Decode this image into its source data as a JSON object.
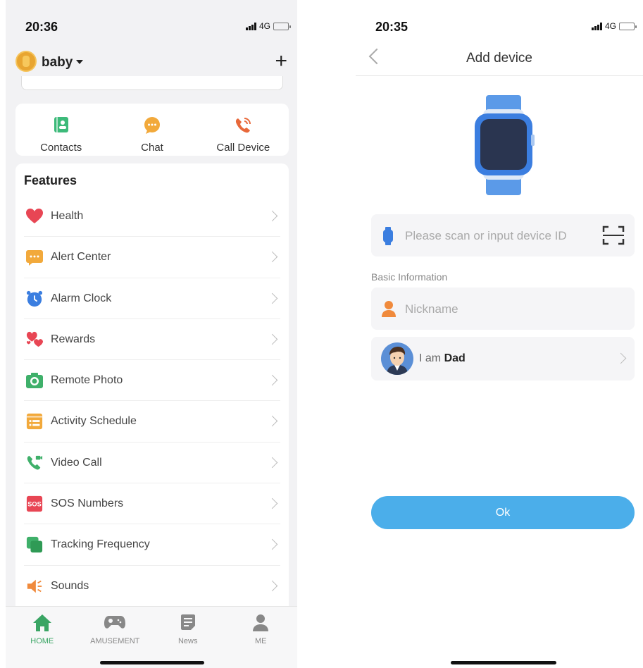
{
  "left": {
    "status": {
      "time": "20:36",
      "network": "4G"
    },
    "header": {
      "device_name": "baby"
    },
    "quick_actions": [
      {
        "label": "Contacts",
        "icon": "contacts-icon",
        "color": "#3dba7a"
      },
      {
        "label": "Chat",
        "icon": "chat-icon",
        "color": "#f2a93b"
      },
      {
        "label": "Call Device",
        "icon": "phone-call-icon",
        "color": "#e8683a"
      }
    ],
    "features": {
      "title": "Features",
      "items": [
        {
          "label": "Health",
          "icon": "heart-icon"
        },
        {
          "label": "Alert Center",
          "icon": "alert-message-icon"
        },
        {
          "label": "Alarm Clock",
          "icon": "alarm-clock-icon"
        },
        {
          "label": "Rewards",
          "icon": "hearts-reward-icon"
        },
        {
          "label": "Remote Photo",
          "icon": "camera-icon"
        },
        {
          "label": "Activity Schedule",
          "icon": "schedule-icon"
        },
        {
          "label": "Video Call",
          "icon": "video-call-icon"
        },
        {
          "label": "SOS Numbers",
          "icon": "sos-icon",
          "icon_text": "SOS"
        },
        {
          "label": "Tracking Frequency",
          "icon": "tracking-icon"
        },
        {
          "label": "Sounds",
          "icon": "speaker-icon"
        }
      ]
    },
    "tabs": [
      {
        "label": "HOME",
        "icon": "home-icon",
        "active": true
      },
      {
        "label": "AMUSEMENT",
        "icon": "gamepad-icon",
        "active": false
      },
      {
        "label": "News",
        "icon": "news-icon",
        "active": false
      },
      {
        "label": "ME",
        "icon": "person-icon",
        "active": false
      }
    ]
  },
  "right": {
    "status": {
      "time": "20:35",
      "network": "4G"
    },
    "nav": {
      "title": "Add device"
    },
    "device_id_field": {
      "placeholder": "Please scan or input device ID"
    },
    "section_label": "Basic Information",
    "nickname_field": {
      "placeholder": "Nickname"
    },
    "role": {
      "prefix": "I am",
      "value": "Dad"
    },
    "ok_label": "Ok"
  },
  "colors": {
    "accent_green": "#3aa564",
    "button_blue": "#4baeea",
    "background_gray": "#f2f2f4"
  }
}
